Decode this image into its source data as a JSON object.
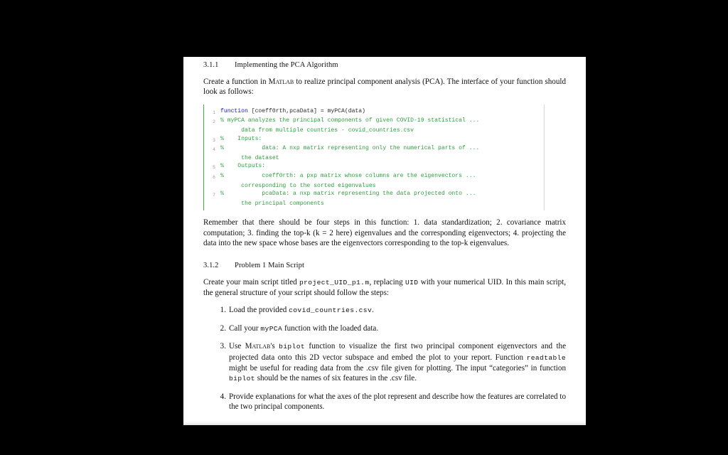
{
  "document": {
    "section_1": {
      "number": "3.1.1",
      "title": "Implementing the PCA Algorithm",
      "intro_part1": "Create a function in ",
      "intro_matlab": "Matlab",
      "intro_part2": " to realize principal component analysis (PCA). The interface of your function should look as follows:"
    },
    "code_listing": {
      "language": "matlab",
      "lines": [
        {
          "number": "1",
          "keyword": "function",
          "rest": " [coeff0rth,pcaData] = myPCA(data)",
          "continuation": ""
        },
        {
          "number": "2",
          "comment": "% myPCA analyzes the principal components of given COVID-19 statistical ...",
          "continuation": "      data from multiple countries - covid_countries.csv"
        },
        {
          "number": "3",
          "comment": "%    Inputs:",
          "continuation": ""
        },
        {
          "number": "4",
          "comment": "%           data: A nxp matrix representing only the numerical parts of ...",
          "continuation": "      the dataset"
        },
        {
          "number": "5",
          "comment": "%    Outputs:",
          "continuation": ""
        },
        {
          "number": "6",
          "comment": "%           coeff0rth: a pxp matrix whose columns are the eigenvectors ...",
          "continuation": "      corresponding to the sorted eigenvalues"
        },
        {
          "number": "7",
          "comment": "%           pcaData: a nxp matrix representing the data projected onto ...",
          "continuation": "      the principal components"
        }
      ]
    },
    "remember_paragraph": "Remember that there should be four steps in this function: 1. data standardization; 2. covariance matrix computation; 3. finding the top-k (k = 2 here) eigenvalues and the corresponding eigenvectors; 4. projecting the data into the new space whose bases are the eigenvectors corresponding to the top-k eigenvalues.",
    "section_2": {
      "number": "3.1.2",
      "title": "Problem 1 Main Script",
      "intro_part1": "Create your main script titled ",
      "intro_code1": "project_UID_p1.m",
      "intro_part2": ", replacing ",
      "intro_code2": "UID",
      "intro_part3": " with your numerical UID. In this main script, the general structure of your script should follow the steps:"
    },
    "steps": [
      {
        "marker": "1.",
        "part1": "Load the provided ",
        "code1": "covid_countries.csv",
        "part2": "."
      },
      {
        "marker": "2.",
        "part1": "Call your ",
        "code1": "myPCA",
        "part2": " function with the loaded data."
      },
      {
        "marker": "3.",
        "part1": "Use ",
        "smallcaps": "Matlab",
        "part2": "'s ",
        "code1": "biplot",
        "part3": " function to visualize the first two principal component eigenvectors and the projected data onto this 2D vector subspace and embed the plot to your report. Function ",
        "code2": "readtable",
        "part4": " might be useful for reading data from the .csv file given for plotting. The input “categories” in function ",
        "code3": "biplot",
        "part5": " should be the names of six features in the .csv file."
      },
      {
        "marker": "4.",
        "part1": "Provide explanations for what the axes of the plot represent and describe how the features are correlated to the two principal components.",
        "code1": "",
        "part2": ""
      }
    ]
  },
  "colors": {
    "page_background": "#ffffff",
    "viewer_background": "#000000",
    "code_keyword": "#1414d6",
    "code_comment": "#2e9e3e",
    "code_linenumber": "#9a9a9a",
    "code_left_rule": "#3fae49",
    "text": "#111111"
  }
}
